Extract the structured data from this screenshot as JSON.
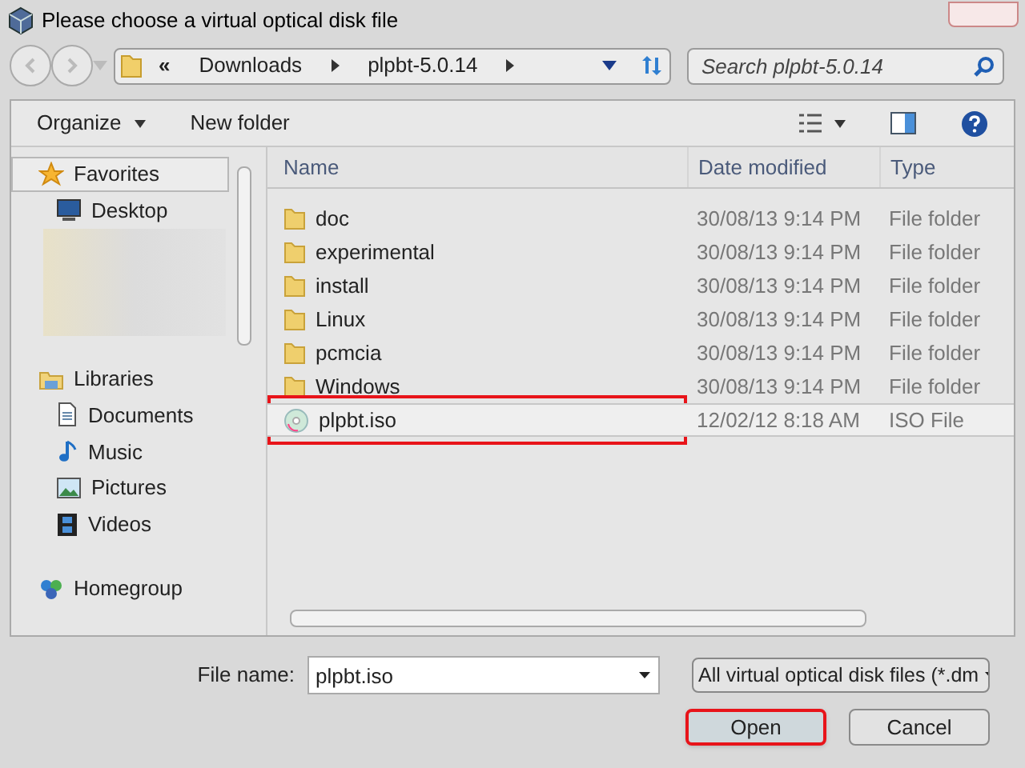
{
  "window": {
    "title": "Please choose a virtual optical disk file"
  },
  "address_bar": {
    "overflow": "«",
    "crumbs": [
      "Downloads",
      "plpbt-5.0.14"
    ]
  },
  "search": {
    "placeholder": "Search plpbt-5.0.14"
  },
  "toolbar": {
    "organize": "Organize",
    "new_folder": "New folder"
  },
  "sidebar": {
    "groups": [
      {
        "label": "Favorites",
        "selected": true,
        "children": [
          {
            "label": "Desktop"
          }
        ]
      },
      {
        "label": "Libraries",
        "selected": false,
        "children": [
          {
            "label": "Documents"
          },
          {
            "label": "Music"
          },
          {
            "label": "Pictures"
          },
          {
            "label": "Videos"
          }
        ]
      },
      {
        "label": "Homegroup",
        "selected": false
      }
    ]
  },
  "table": {
    "columns": [
      "Name",
      "Date modified",
      "Type"
    ],
    "rows": [
      {
        "kind": "folder",
        "name": "doc",
        "date": "30/08/13 9:14 PM",
        "type": "File folder",
        "selected": false,
        "highlighted": false
      },
      {
        "kind": "folder",
        "name": "experimental",
        "date": "30/08/13 9:14 PM",
        "type": "File folder",
        "selected": false,
        "highlighted": false
      },
      {
        "kind": "folder",
        "name": "install",
        "date": "30/08/13 9:14 PM",
        "type": "File folder",
        "selected": false,
        "highlighted": false
      },
      {
        "kind": "folder",
        "name": "Linux",
        "date": "30/08/13 9:14 PM",
        "type": "File folder",
        "selected": false,
        "highlighted": false
      },
      {
        "kind": "folder",
        "name": "pcmcia",
        "date": "30/08/13 9:14 PM",
        "type": "File folder",
        "selected": false,
        "highlighted": false
      },
      {
        "kind": "folder",
        "name": "Windows",
        "date": "30/08/13 9:14 PM",
        "type": "File folder",
        "selected": false,
        "highlighted": false
      },
      {
        "kind": "disc",
        "name": "plpbt.iso",
        "date": "12/02/12 8:18 AM",
        "type": "ISO File",
        "selected": true,
        "highlighted": true
      }
    ]
  },
  "file_name": {
    "label": "File name:",
    "value": "plpbt.iso"
  },
  "file_type": {
    "value": "All virtual optical disk files (*.dm"
  },
  "buttons": [
    {
      "label": "Open",
      "highlighted": true
    },
    {
      "label": "Cancel",
      "highlighted": false
    }
  ]
}
